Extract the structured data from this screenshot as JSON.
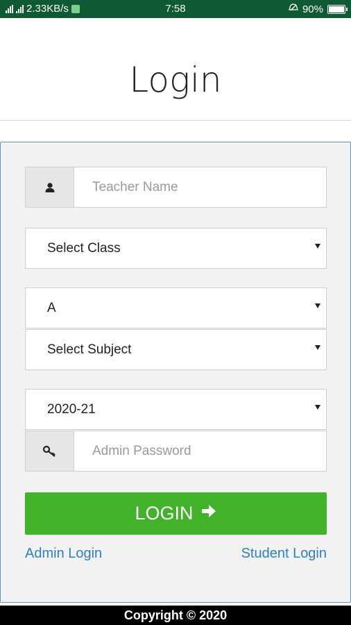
{
  "status_bar": {
    "network_speed": "2.33KB/s",
    "time": "7:58",
    "battery_percent": "90%",
    "battery_level": 0.9
  },
  "header": {
    "title": "Login"
  },
  "form": {
    "teacher_name": {
      "placeholder": "Teacher Name",
      "icon": "user-icon"
    },
    "class_select": {
      "value": "Select Class"
    },
    "section_select": {
      "value": "A"
    },
    "subject_select": {
      "value": "Select Subject"
    },
    "session_select": {
      "value": "2020-21"
    },
    "admin_password": {
      "placeholder": "Admin Password",
      "icon": "key-icon"
    },
    "login_button": {
      "label": "LOGIN",
      "icon": "arrow-right-icon",
      "color": "#42b22a"
    },
    "admin_login_link": "Admin Login",
    "student_login_link": "Student Login"
  },
  "footer": {
    "copyright": "Copyright © 2020"
  },
  "colors": {
    "status_bar": "#0f5a34",
    "link": "#2f7fc4",
    "panel_border": "#6a8fb4"
  }
}
